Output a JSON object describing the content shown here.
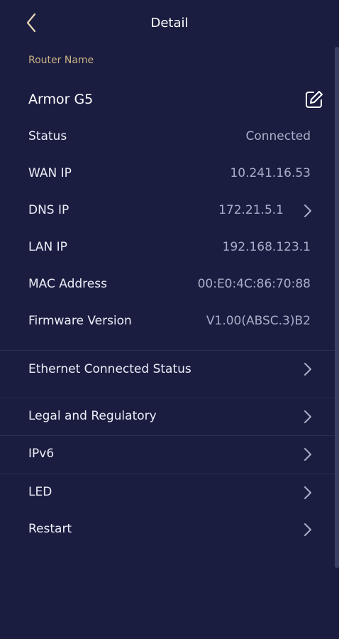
{
  "header": {
    "title": "Detail",
    "back_icon": "chevron-left-icon"
  },
  "router": {
    "section_label": "Router Name",
    "name": "Armor G5",
    "edit_icon": "edit-icon"
  },
  "details": [
    {
      "label": "Status",
      "value": "Connected",
      "has_chevron": false
    },
    {
      "label": "WAN IP",
      "value": "10.241.16.53",
      "has_chevron": false
    },
    {
      "label": "DNS IP",
      "value": "172.21.5.1",
      "has_chevron": true
    },
    {
      "label": "LAN IP",
      "value": "192.168.123.1",
      "has_chevron": false
    },
    {
      "label": "MAC Address",
      "value": "00:E0:4C:86:70:88",
      "has_chevron": false
    },
    {
      "label": "Firmware Version",
      "value": "V1.00(ABSC.3)B2",
      "has_chevron": false
    }
  ],
  "menu": [
    {
      "label": "Ethernet Connected Status"
    },
    {
      "label": "Legal and Regulatory"
    },
    {
      "label": "IPv6"
    },
    {
      "label": "LED"
    },
    {
      "label": "Restart"
    }
  ],
  "colors": {
    "background": "#1a1d40",
    "section_label": "#c9b285",
    "value_text": "#a9aec8",
    "divider": "#2a2e55"
  }
}
